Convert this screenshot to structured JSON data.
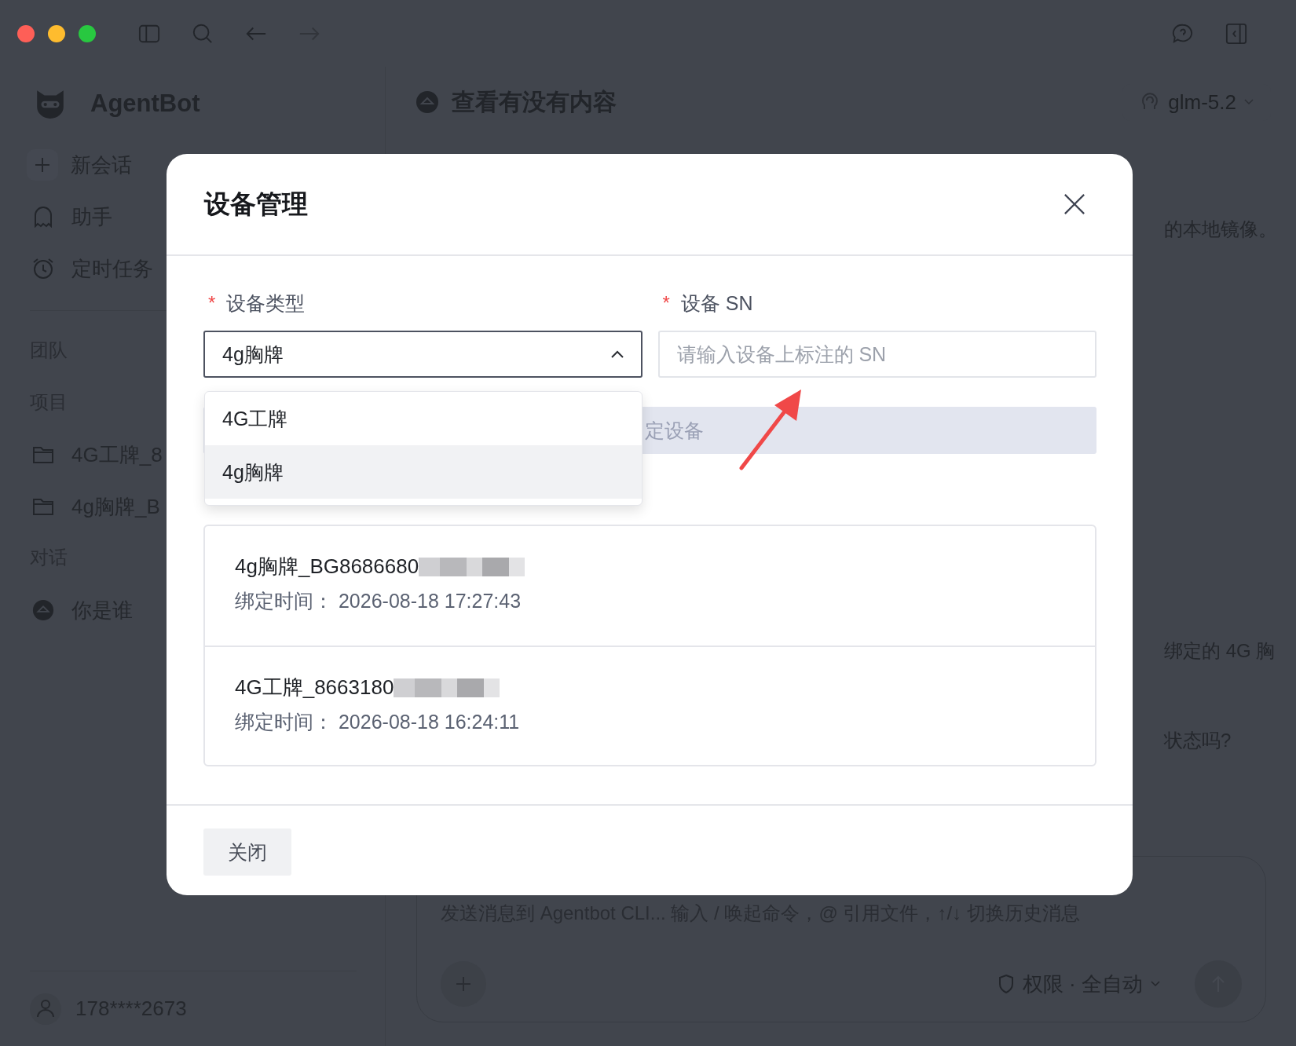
{
  "sidebar": {
    "app_name": "AgentBot",
    "nav": [
      {
        "label": "新会话",
        "kind": "new"
      },
      {
        "label": "助手",
        "kind": "assistant"
      },
      {
        "label": "定时任务",
        "kind": "schedule"
      }
    ],
    "team_heading": "团队",
    "projects": {
      "heading": "项目",
      "items": [
        "4G工牌_8",
        "4g胸牌_B"
      ]
    },
    "chats": {
      "heading": "对话",
      "items": [
        "你是谁"
      ]
    },
    "user": "178****2673"
  },
  "chat": {
    "title": "查看有没有内容",
    "model": "glm-5.2",
    "messages": [
      "的本地镜像。",
      "绑定的 4G 胸",
      "状态吗?"
    ],
    "composer": {
      "placeholder": "发送消息到 Agentbot CLI... 输入 / 唤起命令，@ 引用文件，↑/↓ 切换历史消息",
      "permission": "权限 · 全自动"
    }
  },
  "dialog": {
    "title": "设备管理",
    "fields": [
      {
        "label": "设备类型",
        "required_mark": "*",
        "kind": "select",
        "value": "4g胸牌",
        "expanded": true
      },
      {
        "label": "设备 SN",
        "required_mark": "*",
        "kind": "text",
        "placeholder": "请输入设备上标注的 SN"
      }
    ],
    "bind_button": "定设备",
    "options": [
      {
        "label": "4G工牌",
        "selected": false
      },
      {
        "label": "4g胸牌",
        "selected": true
      }
    ],
    "devices": [
      {
        "name": "4g胸牌_BG8686680",
        "bound_label": "绑定时间：",
        "bound_time": "2026-08-18 17:27:43"
      },
      {
        "name": "4G工牌_8663180",
        "bound_label": "绑定时间：",
        "bound_time": "2026-08-18 16:24:11"
      }
    ],
    "close_button": "关闭"
  }
}
